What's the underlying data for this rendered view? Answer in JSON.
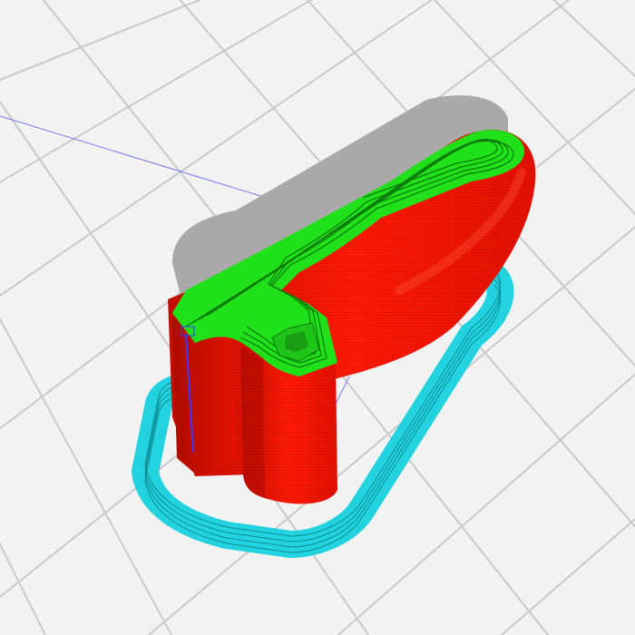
{
  "viewport": {
    "name": "3d-print-preview-viewport"
  },
  "colors": {
    "background": "#f2f2f2",
    "grid_line": "#c9c9c9",
    "skirt": "#22d3df",
    "skirt_line": "#0d8f98",
    "outer_wall": "#e81000",
    "outer_wall_shadow": "#b80c00",
    "inner_wall": "#20e01a",
    "inner_wall_line": "#0b7a09",
    "model_shadow": "#a9a9a9",
    "travel_move": "#3a3aff"
  },
  "legend": {
    "skirt": "skirt-brim-icon",
    "outer_wall": "outer-wall-icon",
    "inner_wall": "inner-wall-icon",
    "travel": "travel-move-icon"
  }
}
